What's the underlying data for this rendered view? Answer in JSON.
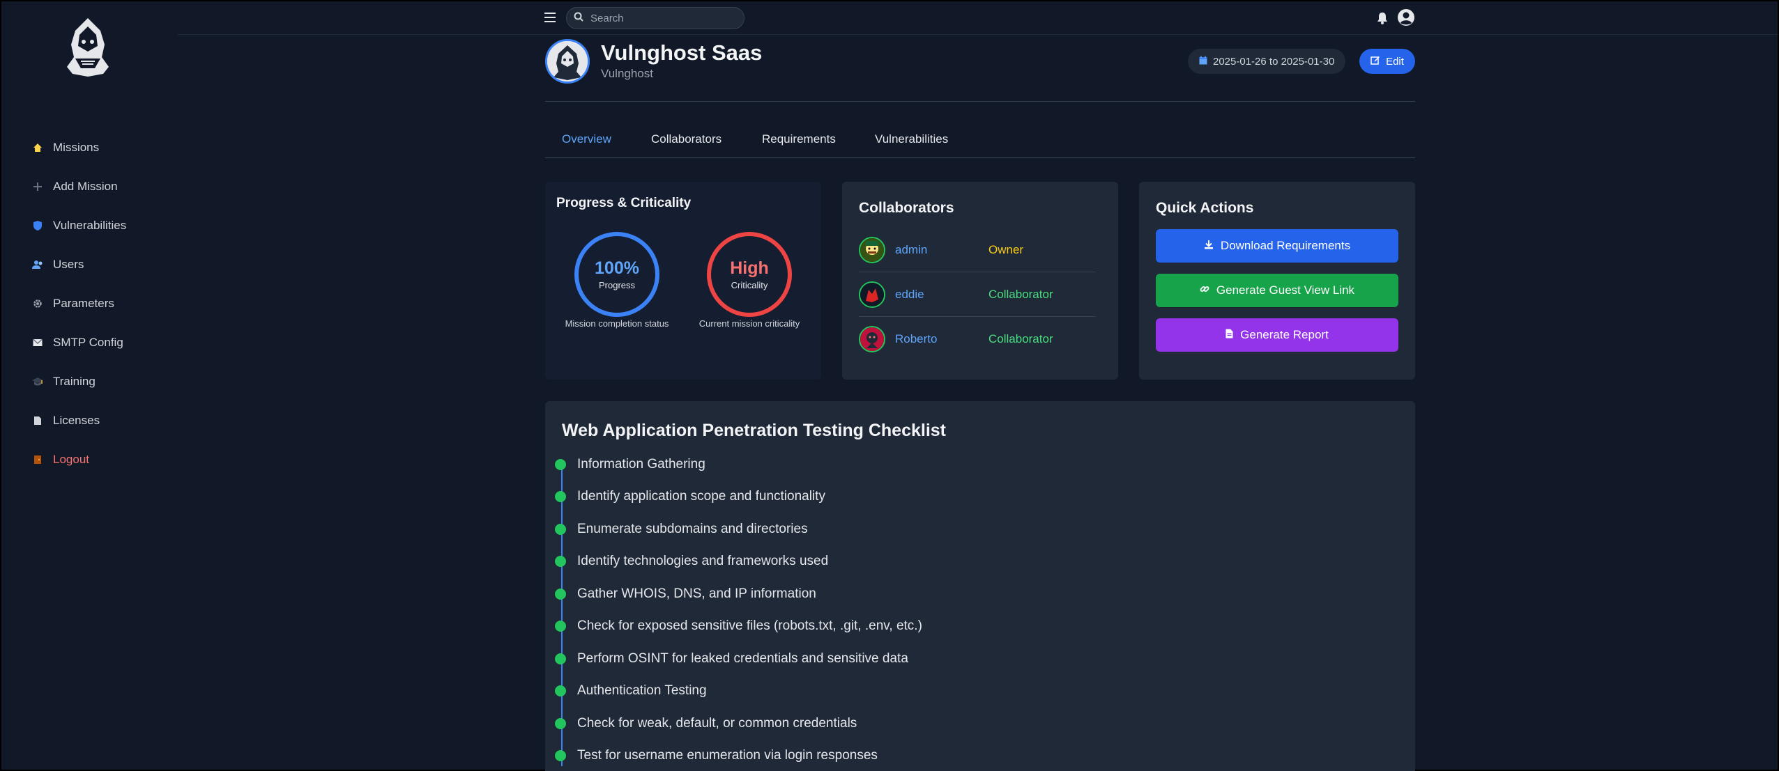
{
  "sidebar": {
    "items": [
      {
        "label": "Missions",
        "icon": "home-icon"
      },
      {
        "label": "Add Mission",
        "icon": "plus-icon"
      },
      {
        "label": "Vulnerabilities",
        "icon": "shield-icon"
      },
      {
        "label": "Users",
        "icon": "users-icon"
      },
      {
        "label": "Parameters",
        "icon": "gear-icon"
      },
      {
        "label": "SMTP Config",
        "icon": "mail-icon"
      },
      {
        "label": "Training",
        "icon": "graduation-cap-icon"
      },
      {
        "label": "Licenses",
        "icon": "document-icon"
      },
      {
        "label": "Logout",
        "icon": "door-icon"
      }
    ]
  },
  "topbar": {
    "search_placeholder": "Search"
  },
  "mission": {
    "title": "Vulnghost Saas",
    "subtitle": "Vulnghost",
    "date_range": "2025-01-26 to 2025-01-30",
    "edit_label": "Edit"
  },
  "tabs": [
    "Overview",
    "Collaborators",
    "Requirements",
    "Vulnerabilities"
  ],
  "progress_card": {
    "title": "Progress & Criticality",
    "progress_value": "100%",
    "progress_label": "Progress",
    "progress_caption": "Mission completion status",
    "criticality_value": "High",
    "criticality_label": "Criticality",
    "criticality_caption": "Current mission criticality"
  },
  "collaborators_card": {
    "title": "Collaborators",
    "items": [
      {
        "name": "admin",
        "role": "Owner"
      },
      {
        "name": "eddie",
        "role": "Collaborator"
      },
      {
        "name": "Roberto",
        "role": "Collaborator"
      }
    ]
  },
  "quick_actions": {
    "title": "Quick Actions",
    "download_label": "Download Requirements",
    "guest_link_label": "Generate Guest View Link",
    "report_label": "Generate Report"
  },
  "checklist": {
    "title": "Web Application Penetration Testing Checklist",
    "items": [
      "Information Gathering",
      "Identify application scope and functionality",
      "Enumerate subdomains and directories",
      "Identify technologies and frameworks used",
      "Gather WHOIS, DNS, and IP information",
      "Check for exposed sensitive files (robots.txt, .git, .env, etc.)",
      "Perform OSINT for leaked credentials and sensitive data",
      "Authentication Testing",
      "Check for weak, default, or common credentials",
      "Test for username enumeration via login responses"
    ]
  },
  "colors": {
    "accent": "#3b82f6",
    "danger": "#ef4444",
    "success": "#22c55e",
    "warning": "#facc15",
    "purple": "#9333ea"
  }
}
